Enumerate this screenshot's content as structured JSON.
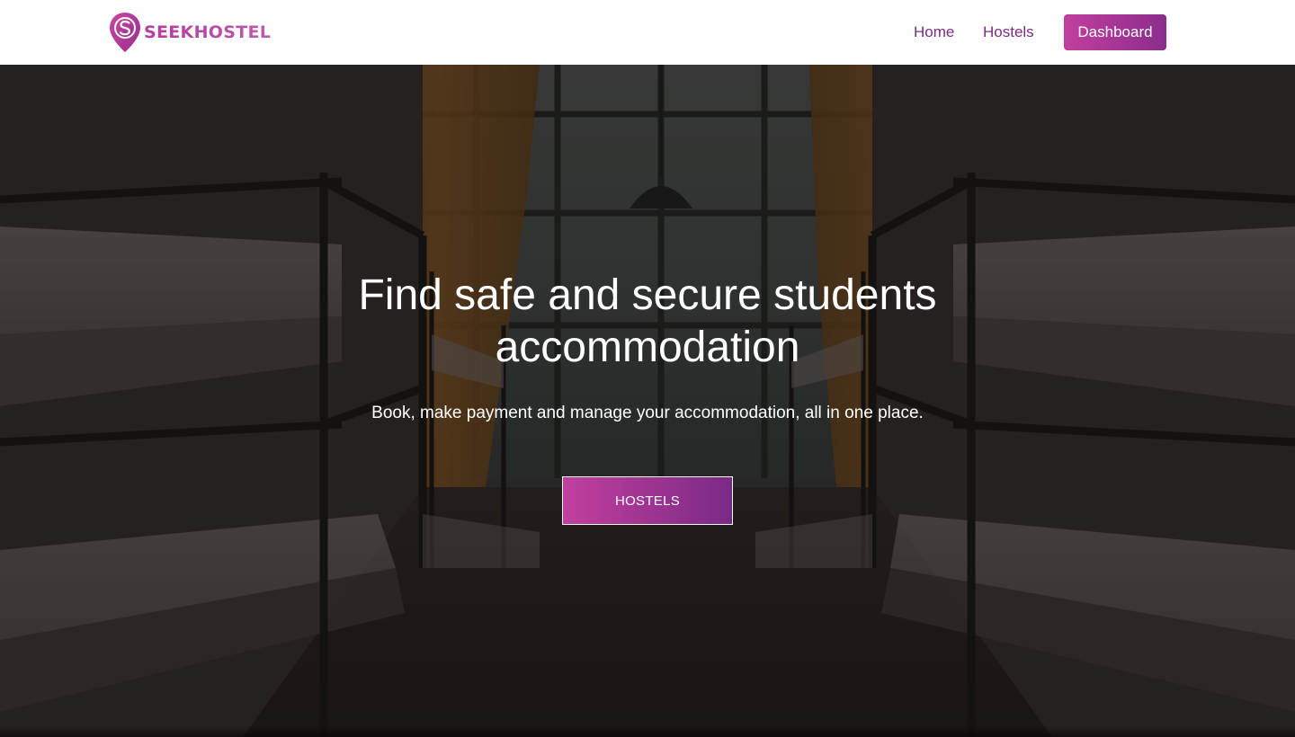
{
  "brand": {
    "name": "SEEKHOSTEL",
    "logo_icon": "map-pin-s-icon",
    "colors": {
      "primary": "#b43a9b",
      "gradient_start": "#c23f9e",
      "gradient_end": "#7a2a86",
      "nav_text": "#7d2c84"
    }
  },
  "nav": {
    "home_label": "Home",
    "hostels_label": "Hostels",
    "dashboard_label": "Dashboard"
  },
  "hero": {
    "title": "Find safe and secure students accommodation",
    "subtitle": "Book, make payment and manage your accommodation, all in one place.",
    "cta_label": "HOSTELS",
    "background": "hostel-dormitory-bunk-beds-photo"
  }
}
